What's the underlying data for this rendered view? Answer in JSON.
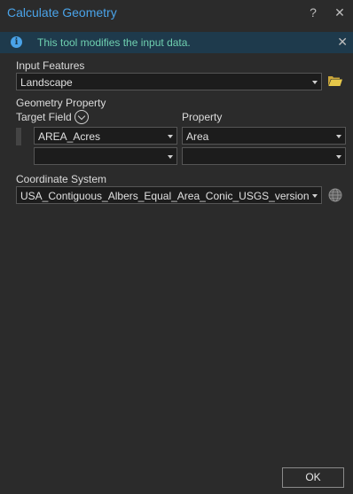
{
  "window": {
    "title": "Calculate Geometry",
    "help_glyph": "?",
    "close_glyph": "✕"
  },
  "banner": {
    "icon": "info-icon",
    "message": "This tool modifies the input data.",
    "close_glyph": "✕"
  },
  "input_features": {
    "label": "Input Features",
    "value": "Landscape",
    "browse_icon": "folder-icon"
  },
  "geometry_property": {
    "label": "Geometry Property",
    "target_field_header": "Target Field",
    "property_header": "Property",
    "rows": [
      {
        "target_field": "AREA_Acres",
        "property": "Area"
      },
      {
        "target_field": "",
        "property": ""
      }
    ]
  },
  "coordinate_system": {
    "label": "Coordinate System",
    "value": "USA_Contiguous_Albers_Equal_Area_Conic_USGS_version",
    "icon": "globe-icon"
  },
  "footer": {
    "ok_label": "OK"
  },
  "colors": {
    "title": "#4aa3e8",
    "banner_bg": "#1e3a4c",
    "banner_text": "#6fd0b0",
    "background": "#2b2b2b",
    "folder": "#e6c84a"
  }
}
